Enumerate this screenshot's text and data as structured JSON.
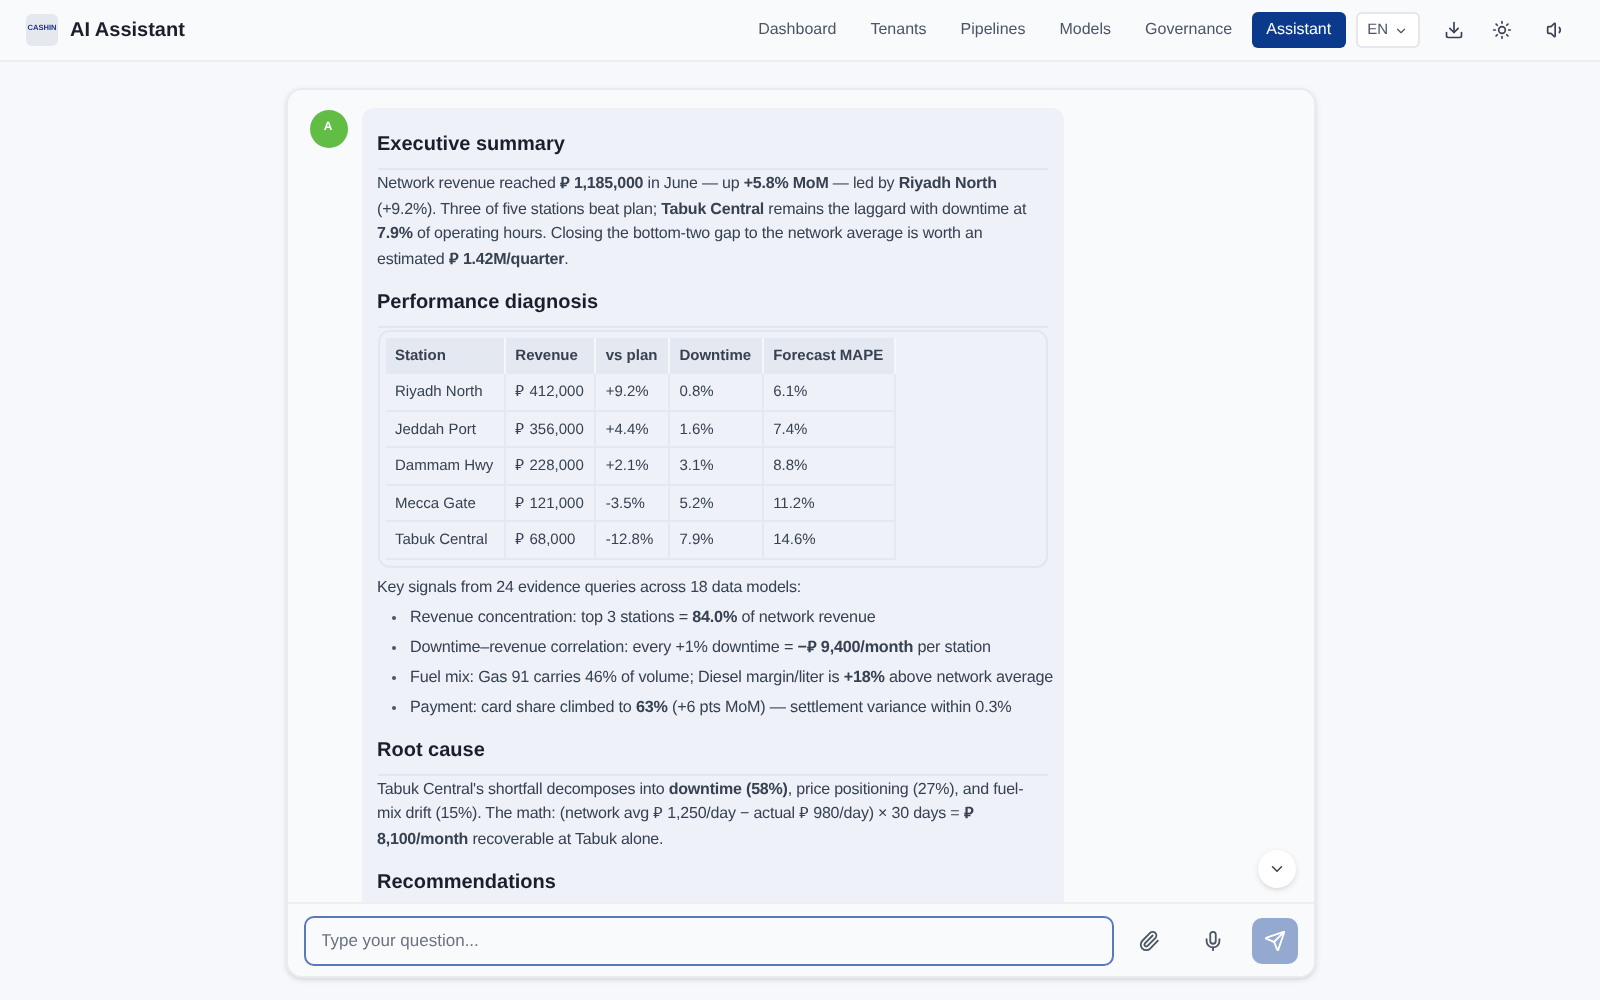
{
  "header": {
    "logo_text": "CASHIN",
    "title": "AI Assistant",
    "nav": [
      {
        "label": "Dashboard",
        "selected": false
      },
      {
        "label": "Tenants",
        "selected": false
      },
      {
        "label": "Pipelines",
        "selected": false
      },
      {
        "label": "Models",
        "selected": false
      },
      {
        "label": "Governance",
        "selected": false
      },
      {
        "label": "Assistant",
        "selected": true
      }
    ],
    "language": "EN"
  },
  "message": {
    "avatar": "A",
    "blocks": [
      {
        "kind": "heading",
        "text": "Executive summary"
      },
      {
        "kind": "paragraph",
        "text": "Network revenue reached **⃁ 1,185,000** in June — up **+5.8% MoM** — led by **Riyadh North** (+9.2%). Three of five stations beat plan; **Tabuk Central** remains the laggard with downtime at **7.9%** of operating hours. Closing the bottom-two gap to the network average is worth an estimated **⃁ 1.42M/quarter**."
      },
      {
        "kind": "heading",
        "text": "Performance diagnosis"
      },
      {
        "kind": "table",
        "columns": [
          "Station",
          "Revenue",
          "vs plan",
          "Downtime",
          "Forecast MAPE"
        ],
        "rows": [
          [
            "Riyadh North",
            "⃁ 412,000",
            "+9.2%",
            "0.8%",
            "6.1%"
          ],
          [
            "Jeddah Port",
            "⃁ 356,000",
            "+4.4%",
            "1.6%",
            "7.4%"
          ],
          [
            "Dammam Hwy",
            "⃁ 228,000",
            "+2.1%",
            "3.1%",
            "8.8%"
          ],
          [
            "Mecca Gate",
            "⃁ 121,000",
            "-3.5%",
            "5.2%",
            "11.2%"
          ],
          [
            "Tabuk Central",
            "⃁ 68,000",
            "-12.8%",
            "7.9%",
            "14.6%"
          ]
        ]
      },
      {
        "kind": "paragraph",
        "text": "Key signals from 24 evidence queries across 18 data models:"
      },
      {
        "kind": "bullets",
        "items": [
          "Revenue concentration: top 3 stations = **84.0%** of network revenue",
          "Downtime–revenue correlation: every +1% downtime = **−⃁ 9,400/month** per station",
          "Fuel mix: Gas 91 carries 46% of volume; Diesel margin/liter is **+18%** above network average",
          "Payment: card share climbed to **63%** (+6 pts MoM) — settlement variance within 0.3%"
        ]
      },
      {
        "kind": "heading",
        "text": "Root cause"
      },
      {
        "kind": "paragraph",
        "text": "Tabuk Central's shortfall decomposes into **downtime (58%)**, price positioning (27%), and fuel-mix drift (15%). The math: (network avg ⃁ 1,250/day − actual ⃁ 980/day) × 30 days = **⃁ 8,100/month** recoverable at Tabuk alone."
      },
      {
        "kind": "heading",
        "text": "Recommendations"
      }
    ]
  },
  "composer": {
    "placeholder": "Type your question..."
  }
}
